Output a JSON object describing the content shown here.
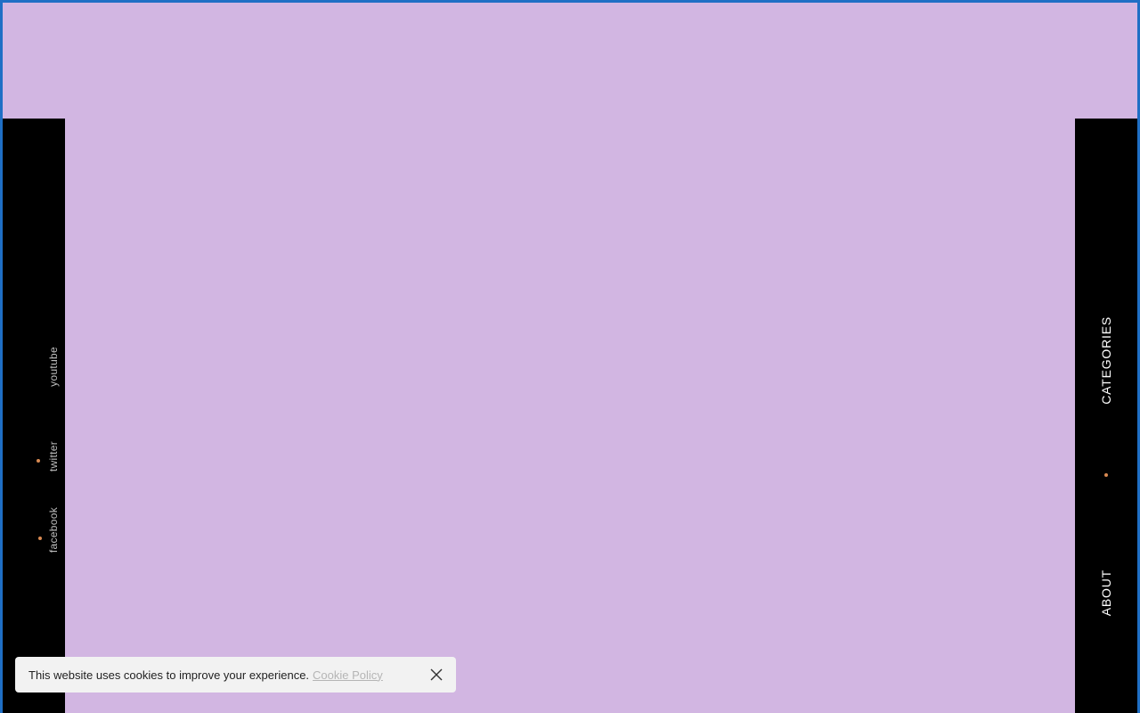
{
  "colors": {
    "page_background": "#d2b6e2",
    "rail_background": "#000000",
    "accent_dot": "#d98a52",
    "frame_border": "#1f6fc5"
  },
  "left_rail": {
    "social_links": [
      {
        "label": "youtube"
      },
      {
        "label": "twitter"
      },
      {
        "label": "facebook"
      }
    ]
  },
  "right_rail": {
    "nav": {
      "categories": "CATEGORIES",
      "about": "ABOUT"
    }
  },
  "cookie_banner": {
    "message": "This website uses cookies to improve your experience.",
    "link_label": "Cookie Policy",
    "close_icon": "close-icon"
  }
}
